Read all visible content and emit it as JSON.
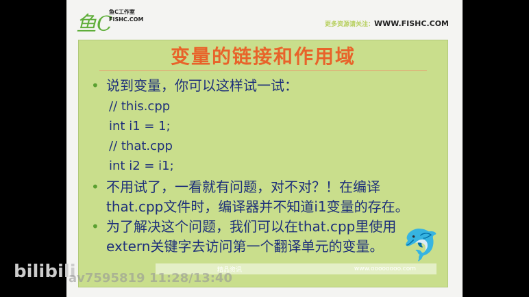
{
  "header": {
    "logo": "鱼C",
    "logo_cn": "鱼C工作室",
    "logo_en": "FISHC.COM",
    "follow_prefix": "更多资源请关注：",
    "site": "WWW.FISHC.COM"
  },
  "title": "变量的链接和作用域",
  "bullets": [
    {
      "text": "说到变量，你可以这样试一试：",
      "code": [
        "// this.cpp",
        "int i1 = 1;",
        "// that.cpp",
        "int i2 = i1;"
      ]
    },
    {
      "lines": [
        "不用试了，一看就有问题，对不对？！在编译",
        "that.cpp文件时，编译器并不知道i1变量的存在。"
      ]
    },
    {
      "lines": [
        "为了解决这个问题，我们可以在that.cpp里使用",
        "extern关键字去访问第一个翻译单元的变量。"
      ]
    }
  ],
  "bullet_char": "•",
  "footer": {
    "left": "精品资讯",
    "right": "www.oooooooo.com"
  },
  "overlay": {
    "brand": "bilibili",
    "watermark": "av7595819 11:28/13:40"
  }
}
